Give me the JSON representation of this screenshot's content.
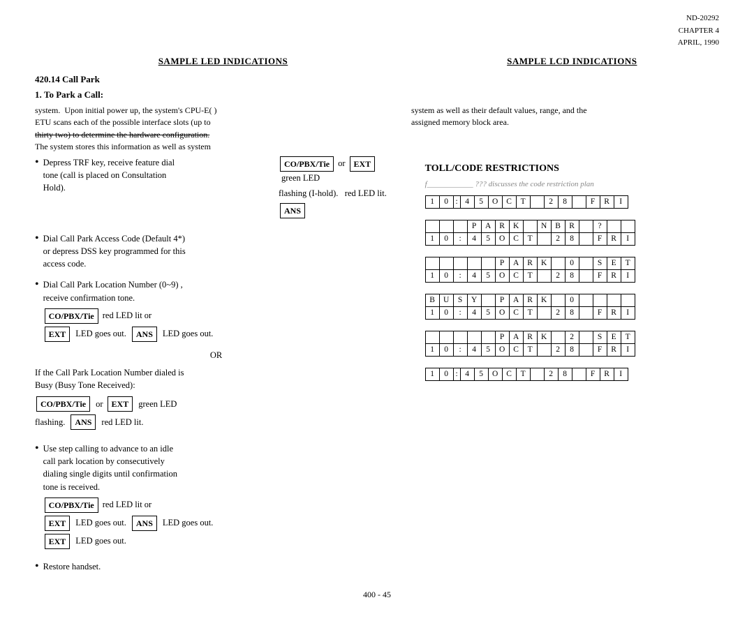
{
  "header": {
    "doc_number": "ND-20292",
    "chapter": "CHAPTER 4",
    "date": "APRIL, 1990"
  },
  "columns": {
    "left_title": "SAMPLE LED INDICATIONS",
    "right_title": "SAMPLE LCD INDICATIONS"
  },
  "section": {
    "number": "420.14",
    "title": "Call Park"
  },
  "subsection": {
    "number": "1.",
    "title": "To Park a Call:"
  },
  "overlap_left_text": "system.  Upon initial power up, the system's CPU-E(  )\nETU scans each of the possible interface slots (up to\nthirty two) to determine the hardware configuration.\nThe system stores this information as well as system",
  "overlap_right_text": "system as well as their default values, range, and the\nassigned memory block area.",
  "toll_header": "TOLL/CODE RESTRICTIONS",
  "toll_sub": "f____________ ???  discusses  the  code  restriction  plan",
  "bullets": [
    {
      "text": "Depress TRF key, receive feature dial tone (call is placed on Consultation Hold)."
    },
    {
      "text": "Dial Call Park Access Code (Default 4*) or depress DSS key programmed for this access code."
    },
    {
      "text": "Dial Call Park Location Number (0~9) , receive confirmation tone."
    },
    {
      "text": "Use step calling to advance to an idle call park location by consecutively dialing single digits until confirmation tone is received."
    },
    {
      "text": "Restore handset."
    }
  ],
  "led_indications": [
    {
      "id": "led1",
      "line1_btn1": "CO/PBX/Tie",
      "line1_or": "or",
      "line1_btn2": "EXT",
      "line1_text": "green LED",
      "line2_text": "flashing (I-hold).",
      "line2_after": "red LED lit.",
      "line2_btn": "ANS"
    },
    {
      "id": "led2",
      "line1_btn1": "CO/PBX/Tie",
      "line1_text": "red LED lit or",
      "line2_btn1": "EXT",
      "line2_text1": "LED goes out.",
      "line2_btn2": "ANS",
      "line2_text2": "LED goes out."
    },
    {
      "id": "led3",
      "line1_btn1": "CO/PBX/Tie",
      "line1_or": "or",
      "line1_btn2": "EXT",
      "line1_text": "green LED",
      "line2_text": "flashing.",
      "line2_btn": "ANS",
      "line2_after": "red LED lit."
    },
    {
      "id": "led4",
      "line1_btn1": "CO/PBX/Tie",
      "line1_text": "red LED lit or",
      "line2_btn1": "EXT",
      "line2_text1": "LED goes out.",
      "line2_btn2": "ANS",
      "line2_text2": "LED goes out."
    },
    {
      "id": "led5",
      "line1_btn1": "EXT",
      "line1_text": "LED goes out."
    }
  ],
  "or_label": "OR",
  "if_busy_text": "If the Call Park Location Number dialed is\nBusy (Busy Tone Received):",
  "lcd_displays": [
    {
      "rows": [
        [
          "1",
          "0",
          ":",
          "4",
          "5",
          "O",
          "C",
          "T",
          "2",
          "8",
          "F",
          "R",
          "I"
        ]
      ]
    },
    {
      "rows": [
        [
          "",
          "",
          "P",
          "A",
          "R",
          "K",
          "N",
          "B",
          "R",
          "?",
          "",
          ""
        ],
        [
          "1",
          "0",
          ":",
          "4",
          "5",
          "O",
          "C",
          "T",
          "2",
          "8",
          "F",
          "R",
          "I"
        ]
      ]
    },
    {
      "rows": [
        [
          "",
          "",
          "",
          "",
          "P",
          "A",
          "R",
          "K",
          "0",
          "S",
          "E",
          "T"
        ],
        [
          "1",
          "0",
          ":",
          "4",
          "5",
          "O",
          "C",
          "T",
          "2",
          "8",
          "F",
          "R",
          "I"
        ]
      ]
    },
    {
      "rows": [
        [
          "B",
          "U",
          "S",
          "Y",
          "P",
          "A",
          "R",
          "K",
          "0",
          "",
          "",
          ""
        ],
        [
          "1",
          "0",
          ":",
          "4",
          "5",
          "O",
          "C",
          "T",
          "2",
          "8",
          "F",
          "R",
          "I"
        ]
      ]
    },
    {
      "rows": [
        [
          "",
          "",
          "",
          "",
          "P",
          "A",
          "R",
          "K",
          "2",
          "S",
          "E",
          "T"
        ],
        [
          "1",
          "0",
          ":",
          "4",
          "5",
          "O",
          "C",
          "T",
          "2",
          "8",
          "F",
          "R",
          "I"
        ]
      ]
    },
    {
      "rows": [
        [
          "1",
          "0",
          ":",
          "4",
          "5",
          "O",
          "C",
          "T",
          "2",
          "8",
          "F",
          "R",
          "I"
        ]
      ]
    }
  ],
  "page_number": "400 - 45"
}
